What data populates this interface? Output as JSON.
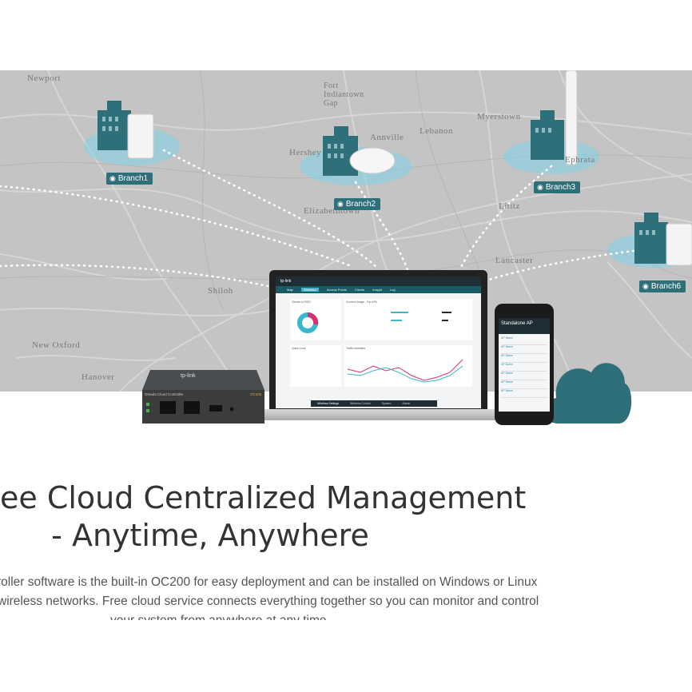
{
  "map": {
    "places": [
      "Newport",
      "Fort Indiantown Gap",
      "Myerstown",
      "Lebanon",
      "Annville",
      "Hershey",
      "Ephrata",
      "Elizabethtown",
      "Lititz",
      "Shiloh",
      "New Oxford",
      "Hanover",
      "Lancaster"
    ],
    "branches": [
      "Branch1",
      "Branch2",
      "Branch3",
      "Branch6"
    ],
    "accent_color": "#2f6f7a"
  },
  "laptop": {
    "brand": "tp-link",
    "nav_tabs": [
      "Map",
      "Statistics",
      "Access Points",
      "Clients",
      "Insight",
      "Log"
    ],
    "panels": {
      "clients_title": "Clients of SSID",
      "usage_title": "Current Usage - Top APs",
      "quick_look_title": "Quick Look",
      "traffic_title": "Traffic Activities"
    },
    "bottom_tabs": [
      "Wireless Settings",
      "Wireless Control",
      "System",
      "Admin"
    ]
  },
  "phone": {
    "header": "Standalone AP",
    "list_item_label": "AP Name"
  },
  "device": {
    "brand": "tp-link",
    "label": "Omada Cloud Controller",
    "model": "OC200"
  },
  "headline": {
    "line1": "ee Cloud Centralized Management",
    "line2": "- Anytime, Anywhere"
  },
  "description": {
    "line1": "roller software is the built-in OC200 for easy deployment and can be installed on Windows or Linux",
    "line2": "wireless networks. Free cloud service connects everything together so you can monitor and control",
    "line3": "your system from anywhere at any time."
  }
}
